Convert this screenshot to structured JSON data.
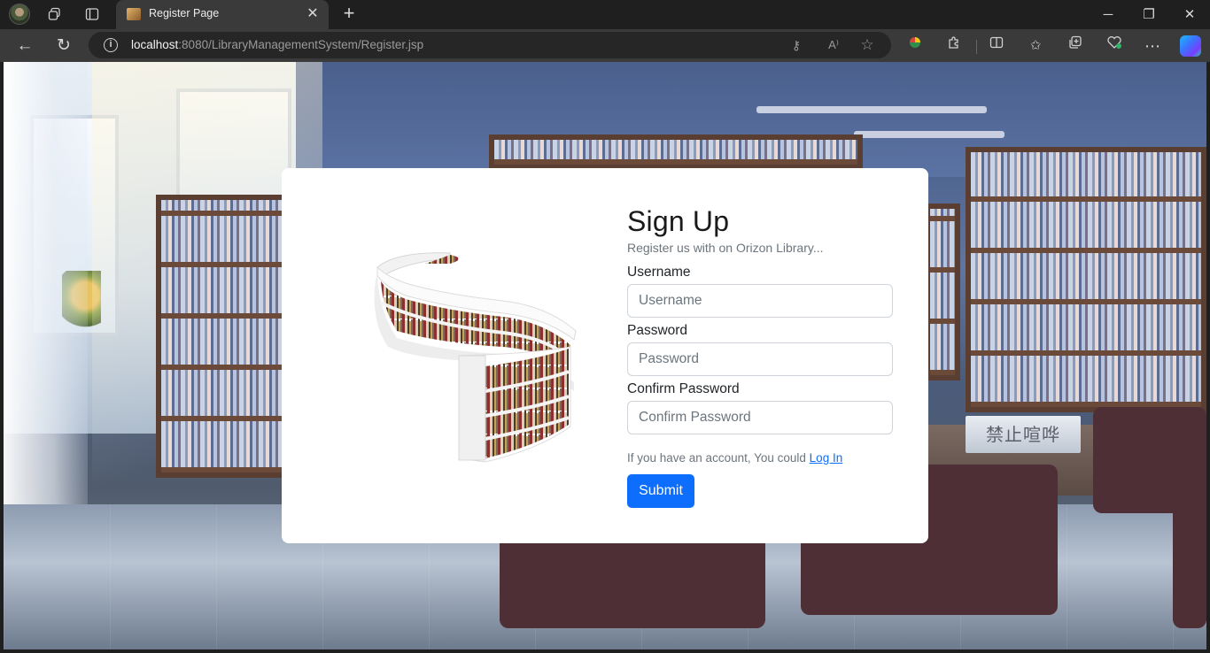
{
  "browser": {
    "tab_title": "Register Page",
    "url_host": "localhost",
    "url_path": ":8080/LibraryManagementSystem/Register.jsp",
    "accent": "#0d6efd"
  },
  "background": {
    "sign_text": "禁止喧哗"
  },
  "form": {
    "title": "Sign Up",
    "subtitle": "Register us with on Orizon Library...",
    "username_label": "Username",
    "username_placeholder": "Username",
    "password_label": "Password",
    "password_placeholder": "Password",
    "confirm_label": "Confirm Password",
    "confirm_placeholder": "Confirm Password",
    "hint_text": "If you have an account, You could ",
    "login_link": "Log In",
    "submit_label": "Submit"
  },
  "icons": {
    "profile": "profile-avatar-icon",
    "workspaces": "workspaces-icon",
    "tab_actions": "tab-actions-icon",
    "favicon": "library-favicon-icon",
    "close": "close-icon",
    "new_tab": "plus-icon",
    "minimize": "minimize-icon",
    "restore": "restore-icon",
    "window_close": "window-close-icon",
    "back": "back-arrow-icon",
    "reload": "reload-icon",
    "info": "info-icon",
    "key": "key-icon",
    "read_aloud": "read-aloud-icon",
    "favorite": "star-icon",
    "extensions": "puzzle-icon",
    "split": "split-screen-icon",
    "favorites": "favorites-icon",
    "collections": "collections-icon",
    "browser_essentials": "heart-pulse-icon",
    "more": "more-icon",
    "copilot": "copilot-icon"
  }
}
